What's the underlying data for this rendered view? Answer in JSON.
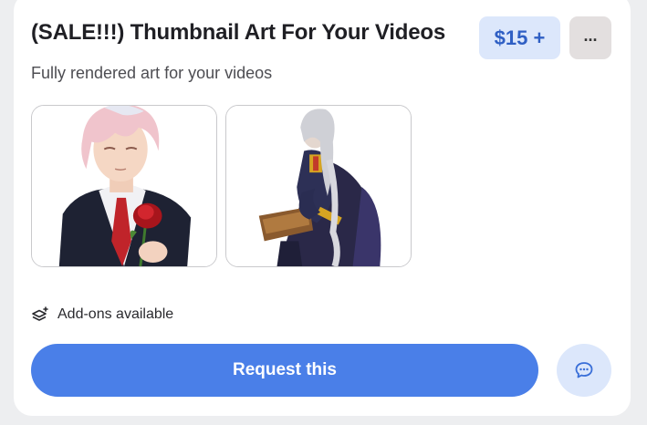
{
  "listing": {
    "title": "(SALE!!!) Thumbnail Art For Your Videos",
    "price": "$15 +",
    "more_label": "...",
    "subtitle": "Fully rendered art for your videos",
    "thumbnails": [
      {
        "subject": "pink-haired man in suit holding red rose"
      },
      {
        "subject": "silver-haired armored knight holding a book"
      }
    ],
    "addons_label": "Add-ons available",
    "request_label": "Request this"
  },
  "colors": {
    "accent": "#4a7fe8",
    "price_bg": "#dce7fb",
    "price_text": "#2f5fc4",
    "more_bg": "#e3dfdf"
  },
  "icons": {
    "addons": "layers-plus-icon",
    "chat": "chat-bubble-icon",
    "more": "ellipsis-icon"
  }
}
